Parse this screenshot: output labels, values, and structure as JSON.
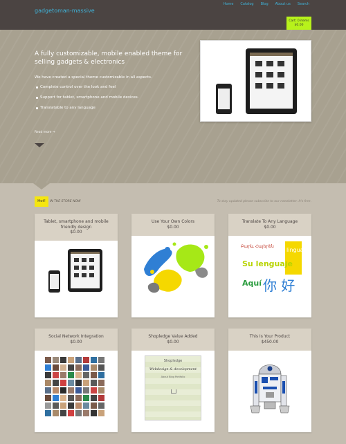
{
  "header": {
    "logo": "gadgetoman-massive",
    "nav": [
      "Home",
      "Catalog",
      "Blog",
      "About us",
      "Search"
    ],
    "cart": {
      "label": "Cart: 0 items",
      "total": "$0.00"
    },
    "accent": "#b7f21b"
  },
  "hero": {
    "title": "A fully customizable, mobile enabled theme for selling gadgets & electronics",
    "intro": "We have created a special theme customizable in all aspects.",
    "features": [
      "Complete control over the look and feel",
      "Support for tablet, smartphone and mobile devices.",
      "Translatable to any language"
    ],
    "read_more": "Read more →"
  },
  "store": {
    "badge": "Hot!",
    "label": "IN THE STORE NOW",
    "newsletter": "To stay updated please subscribe to our newsletter. It's free."
  },
  "products": [
    {
      "title": "Tablet, smartphone and mobile friendly design",
      "price": "$0.00",
      "image": "tablet-phone"
    },
    {
      "title": "Use Your Own Colors",
      "price": "$0.00",
      "image": "paint-splashes"
    },
    {
      "title": "Translate To Any Language",
      "price": "$0.00",
      "image": "languages"
    },
    {
      "title": "Social Network Integration",
      "price": "$0.00",
      "image": "avatar-grid"
    },
    {
      "title": "Shopledge Value Added",
      "price": "$0.00",
      "image": "sketch"
    },
    {
      "title": "This Is Your Product",
      "price": "$450.00",
      "image": "robot"
    }
  ],
  "images": {
    "languages": {
      "line1": "Բարև Հայերեն",
      "line2": "Su lenguaje",
      "line3": "Aquí",
      "cjk": "你 好",
      "side": "lingua"
    },
    "sketch": {
      "heading": "Shopledge",
      "script": "Webdesign & development",
      "menu": "About  Blog  Portfolio"
    }
  }
}
